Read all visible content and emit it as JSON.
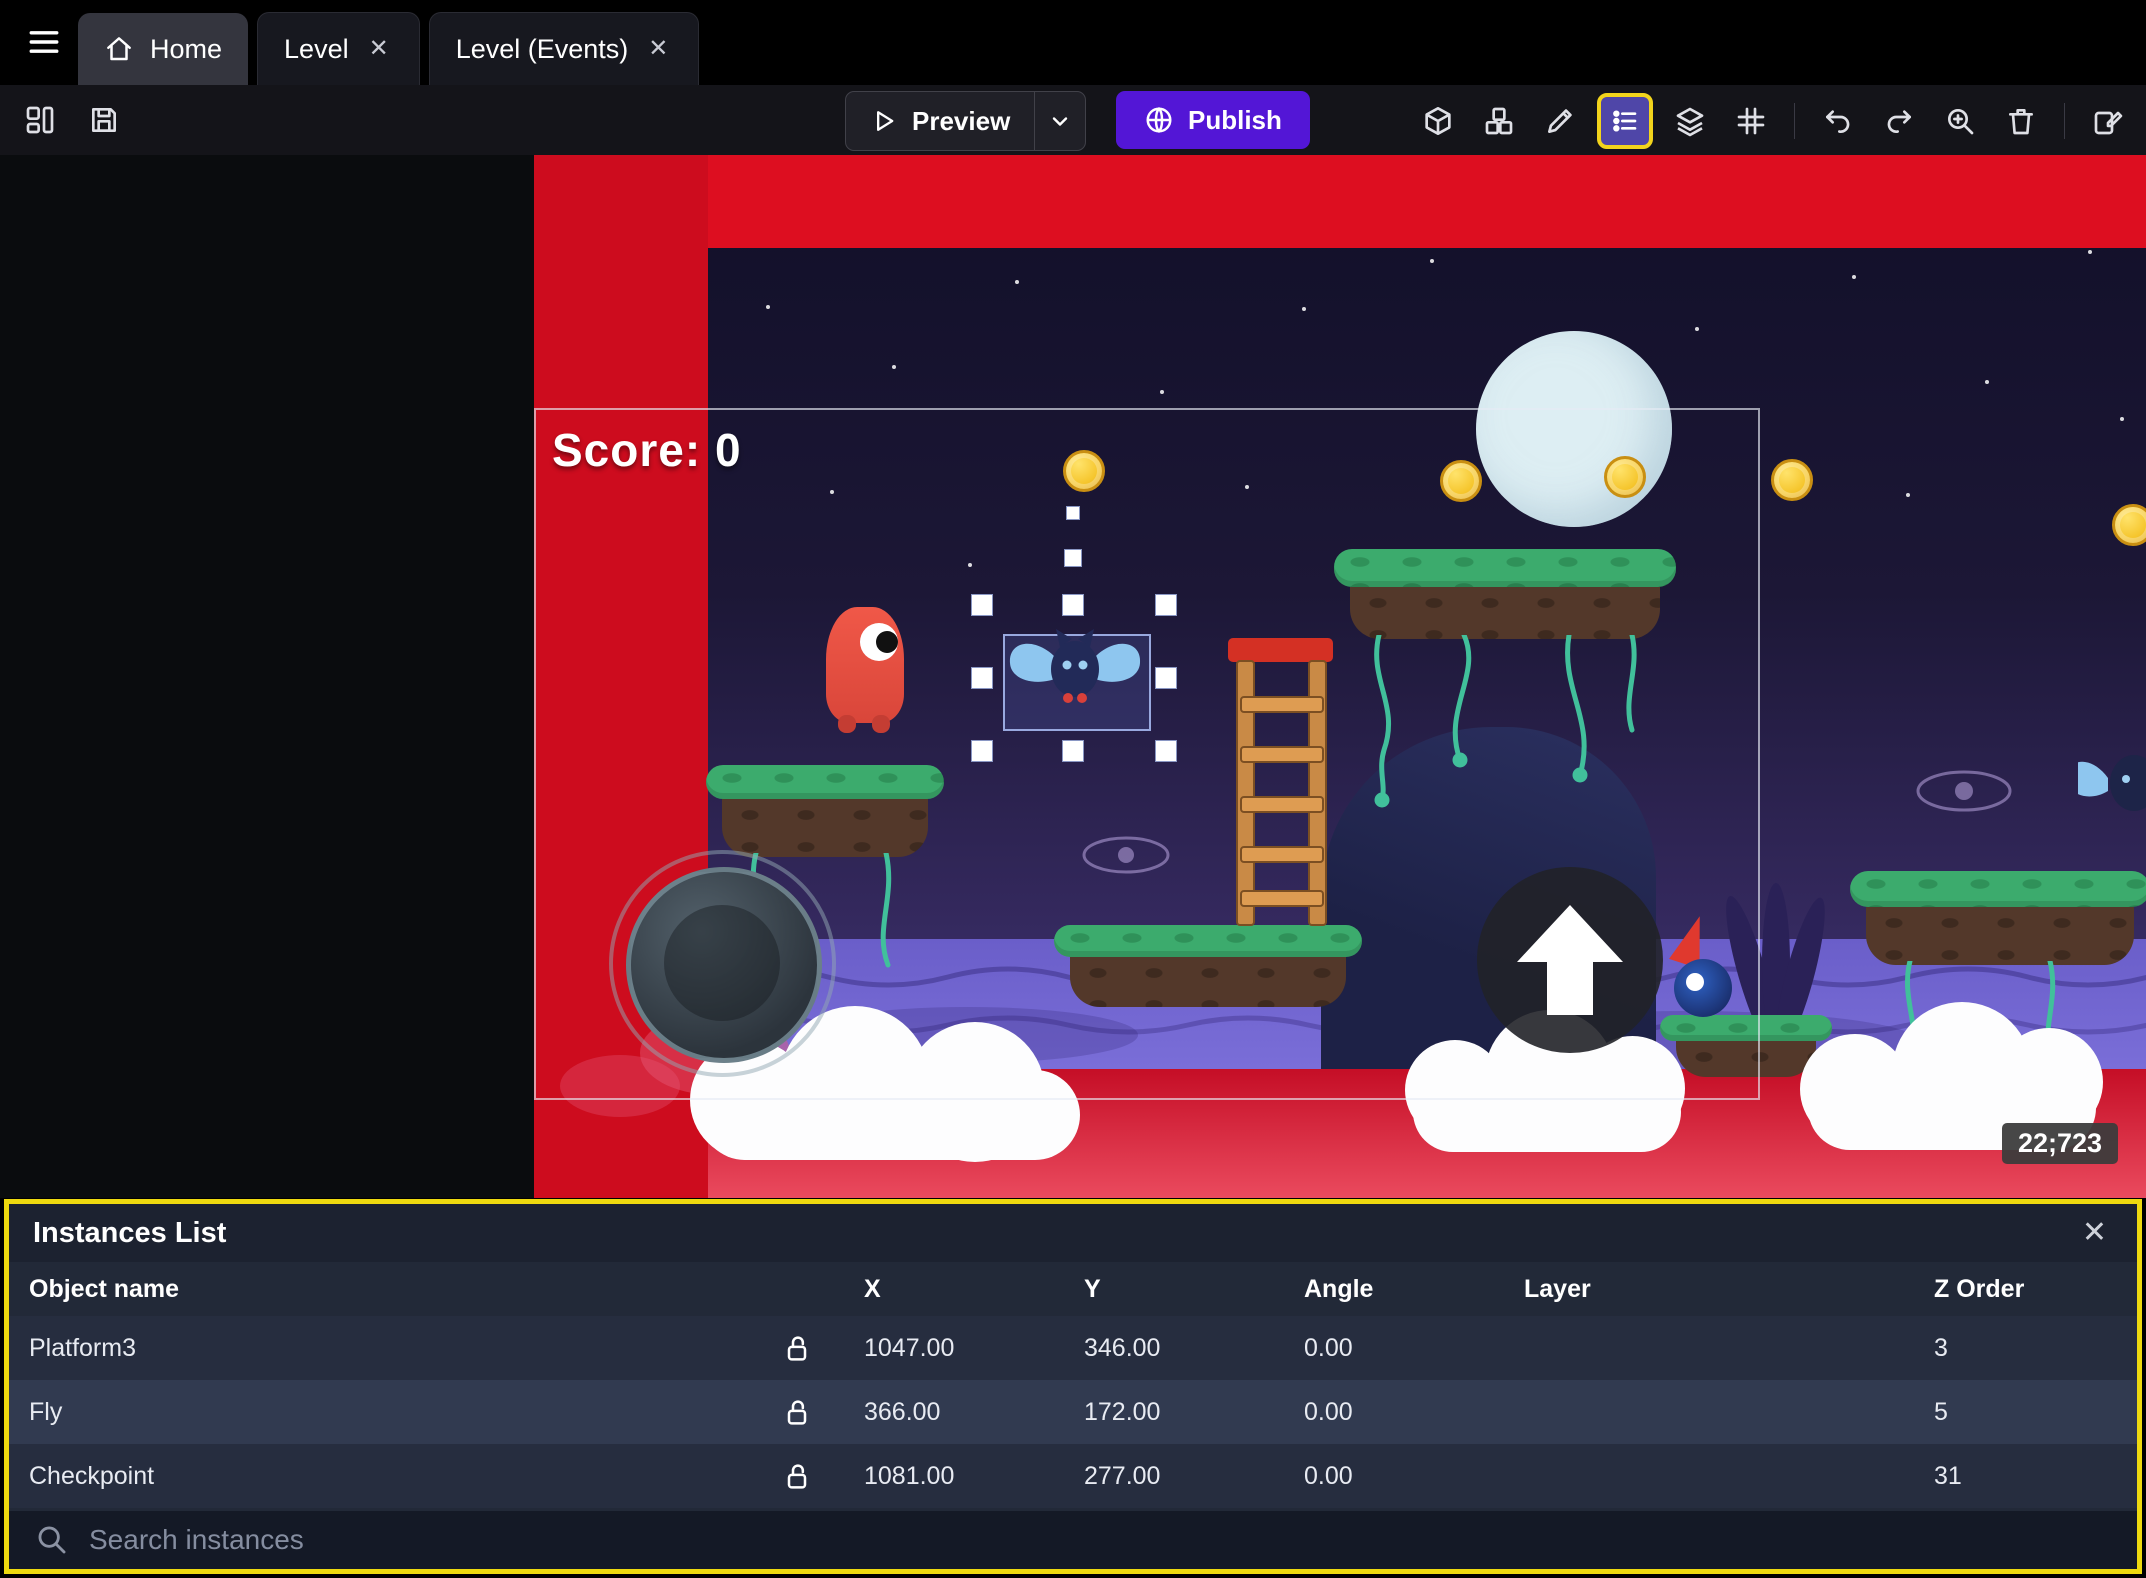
{
  "tabs": {
    "home": "Home",
    "level": "Level",
    "level_events": "Level (Events)"
  },
  "ui": {
    "close_glyph": "✕"
  },
  "toolbar": {
    "preview_label": "Preview",
    "publish_label": "Publish"
  },
  "scene": {
    "score_text": "Score: 0",
    "coords_badge": "22;723"
  },
  "instances_panel": {
    "title": "Instances List",
    "columns": [
      "Object name",
      "X",
      "Y",
      "Angle",
      "Layer",
      "Z Order"
    ],
    "rows": [
      {
        "name": "Platform3",
        "x": "1047.00",
        "y": "346.00",
        "angle": "0.00",
        "layer": "",
        "z": "3"
      },
      {
        "name": "Fly",
        "x": "366.00",
        "y": "172.00",
        "angle": "0.00",
        "layer": "",
        "z": "5"
      },
      {
        "name": "Checkpoint",
        "x": "1081.00",
        "y": "277.00",
        "angle": "0.00",
        "layer": "",
        "z": "31"
      }
    ],
    "search_placeholder": "Search instances"
  },
  "colors": {
    "publish_button": "#5316d6",
    "annotation_highlight": "#f2d41c",
    "selection_purple": "#4f46a8"
  }
}
